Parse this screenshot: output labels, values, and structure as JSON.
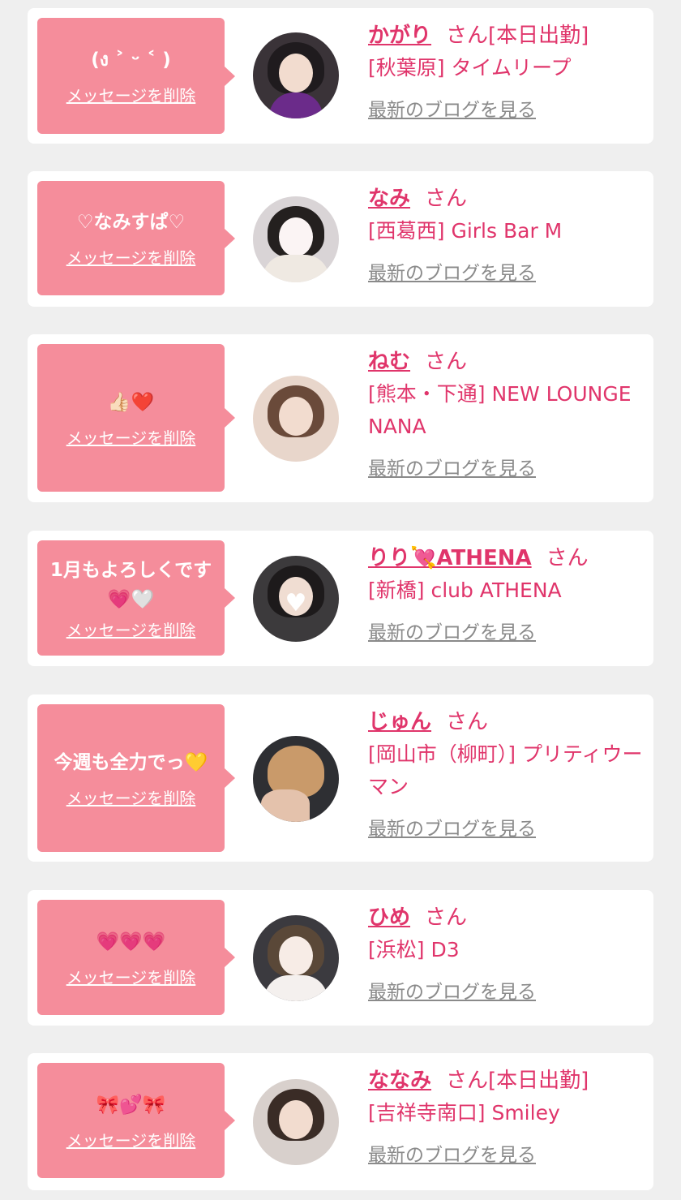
{
  "delete_label": "メッセージを削除",
  "blog_label": "最新のブログを見る",
  "san_label": "さん",
  "colors": {
    "accent": "#e0356b",
    "bubble": "#f58d9b",
    "link_gray": "#8a8a8a",
    "background": "#efefef"
  },
  "items": [
    {
      "message": "(ง ˃ ᵕ ˂ )",
      "name": "かがり",
      "status": "[本日出勤]",
      "shop": "[秋葉原] タイムリープ"
    },
    {
      "message": "♡なみすぱ♡",
      "name": "なみ",
      "status": "",
      "shop": "[西葛西] Girls Bar M"
    },
    {
      "message": "👍🏻❤️",
      "name": "ねむ",
      "status": "",
      "shop": "[熊本・下通] NEW LOUNGE NANA"
    },
    {
      "message": "1月もよろしくです💗🤍",
      "name": "りり💘ATHENA",
      "status": "",
      "shop": "[新橋] club ATHENA"
    },
    {
      "message": "今週も全力でっ💛",
      "name": "じゅん",
      "status": "",
      "shop": "[岡山市（柳町）] プリティウーマン"
    },
    {
      "message": "💗💗💗",
      "name": "ひめ",
      "status": "",
      "shop": "[浜松] D3"
    },
    {
      "message": "🎀💕🎀",
      "name": "ななみ",
      "status": "[本日出勤]",
      "shop": "[吉祥寺南口] Smiley"
    }
  ]
}
